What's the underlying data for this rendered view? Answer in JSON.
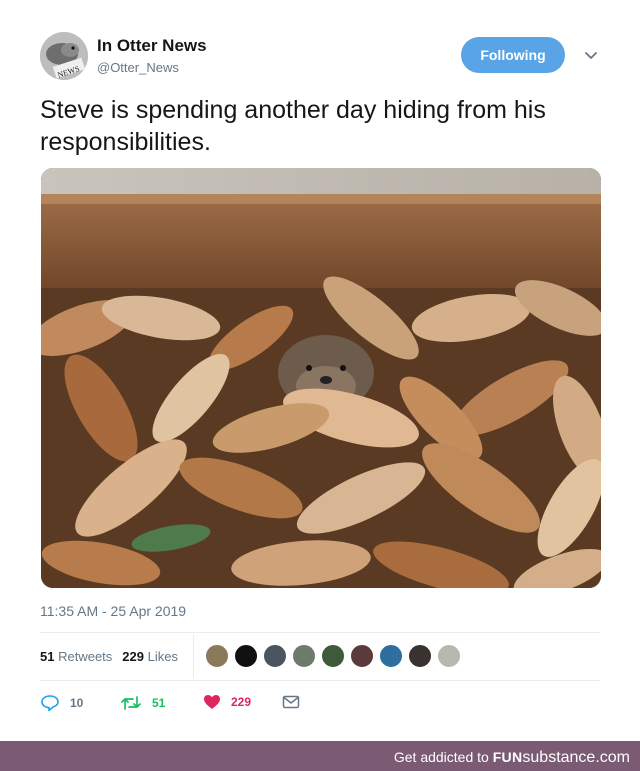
{
  "account": {
    "name": "In Otter News",
    "handle": "@Otter_News",
    "avatar_badge": "NEWS"
  },
  "follow_button": {
    "label": "Following"
  },
  "tweet": {
    "text": "Steve is spending another day hiding from his responsibilities.",
    "timestamp": "11:35 AM - 25 Apr 2019",
    "photo_icon": "otter-in-leaves-photo"
  },
  "stats": {
    "retweets_count": "51",
    "retweets_label": "Retweets",
    "likes_count": "229",
    "likes_label": "Likes",
    "liker_colors": [
      "#8a7a5a",
      "#111111",
      "#4a5560",
      "#6d7b6a",
      "#3f5a3a",
      "#5a3a3a",
      "#2f6f9f",
      "#3a3230",
      "#b8b8b0"
    ]
  },
  "actions": {
    "reply_count": "10",
    "retweet_count": "51",
    "like_count": "229",
    "colors": {
      "reply": "#1da1f2",
      "retweet": "#17bf63",
      "like": "#e0245e",
      "dm": "#657786"
    }
  },
  "footer": {
    "text": "Get addicted to",
    "brand_part1": "FUN",
    "brand_part2": "substance",
    "brand_part3": ".com",
    "background": "#7b5a73"
  }
}
